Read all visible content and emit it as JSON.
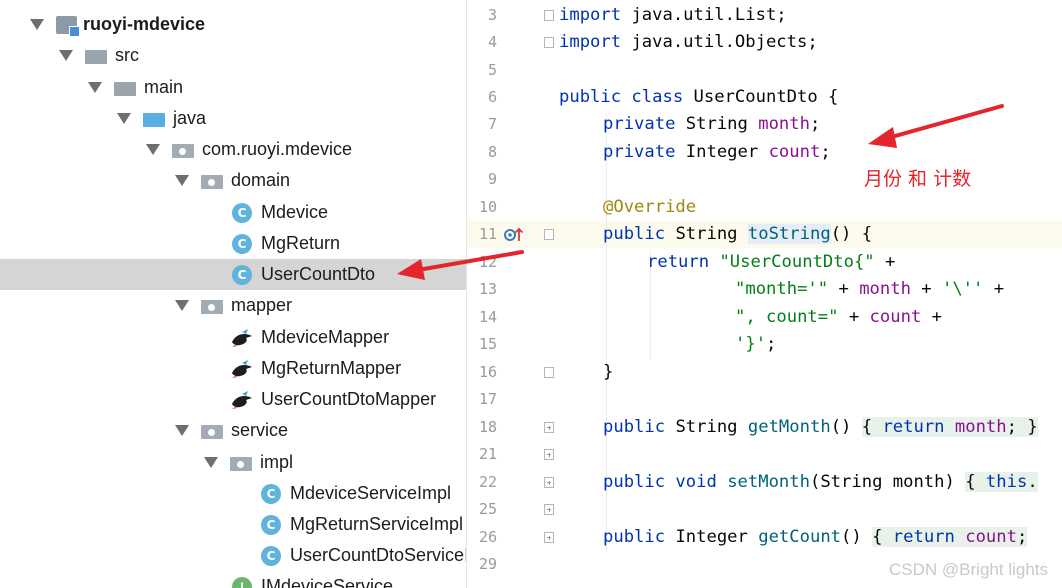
{
  "project_tree": {
    "items": [
      {
        "label": "ruoyi-mdevice",
        "icon": "module-icon",
        "expanded": true
      },
      {
        "label": "src",
        "icon": "folder-icon",
        "expanded": true
      },
      {
        "label": "main",
        "icon": "folder-icon",
        "expanded": true
      },
      {
        "label": "java",
        "icon": "source-folder-icon",
        "expanded": true
      },
      {
        "label": "com.ruoyi.mdevice",
        "icon": "package-icon",
        "expanded": true
      },
      {
        "label": "domain",
        "icon": "package-icon",
        "expanded": true
      },
      {
        "label": "Mdevice",
        "icon": "class-icon"
      },
      {
        "label": "MgReturn",
        "icon": "class-icon"
      },
      {
        "label": "UserCountDto",
        "icon": "class-icon",
        "selected": true
      },
      {
        "label": "mapper",
        "icon": "package-icon",
        "expanded": true
      },
      {
        "label": "MdeviceMapper",
        "icon": "mybatis-mapper-icon"
      },
      {
        "label": "MgReturnMapper",
        "icon": "mybatis-mapper-icon"
      },
      {
        "label": "UserCountDtoMapper",
        "icon": "mybatis-mapper-icon"
      },
      {
        "label": "service",
        "icon": "package-icon",
        "expanded": true
      },
      {
        "label": "impl",
        "icon": "package-icon",
        "expanded": true
      },
      {
        "label": "MdeviceServiceImpl",
        "icon": "class-icon"
      },
      {
        "label": "MgReturnServiceImpl",
        "icon": "class-icon"
      },
      {
        "label": "UserCountDtoServiceImpl",
        "icon": "class-icon"
      },
      {
        "label": "IMdeviceService",
        "icon": "interface-icon"
      }
    ],
    "class_badge": "C",
    "interface_badge": "I"
  },
  "editor": {
    "line_numbers": [
      "3",
      "4",
      "5",
      "6",
      "7",
      "8",
      "9",
      "10",
      "11",
      "12",
      "13",
      "14",
      "15",
      "16",
      "17",
      "18",
      "21",
      "22",
      "25",
      "26",
      "29"
    ],
    "code": {
      "l3": {
        "kw": "import",
        "rest": " java.util.List;"
      },
      "l4": {
        "kw": "import",
        "rest": " java.util.Objects;"
      },
      "l6": {
        "kw": "public class",
        "rest": " UserCountDto {"
      },
      "l7": {
        "kw": "private",
        "type": " String ",
        "field": "month",
        "end": ";"
      },
      "l8": {
        "kw": "private",
        "type": " Integer ",
        "field": "count",
        "end": ";"
      },
      "l10": {
        "annotation": "@Override"
      },
      "l11": {
        "kw": "public",
        "type": " String ",
        "method": "toString",
        "end": "() {"
      },
      "l12": {
        "kw": "return",
        "str": " \"UserCountDto{\"",
        "end": " +"
      },
      "l13": {
        "str": "\"month='\"",
        "mid": " + ",
        "field": "month",
        "end": " + ",
        "str2": "'\\''",
        "end2": " +"
      },
      "l14": {
        "str": "\", count=\"",
        "mid": " + ",
        "field": "count",
        "end": " +"
      },
      "l15": {
        "str": "'}'",
        "end": ";"
      },
      "l16": {
        "end": "}"
      },
      "l18": {
        "kw": "public",
        "type": " String ",
        "method": "getMonth",
        "end": "() ",
        "fold": "{ ",
        "kw2": "return",
        "field": " month",
        "end2": "; }"
      },
      "l22": {
        "kw": "public void",
        "type": " ",
        "method": "setMonth",
        "end": "(String month) ",
        "fold": "{ ",
        "kw2": "this",
        "end2": "."
      },
      "l26": {
        "kw": "public",
        "type": " Integer ",
        "method": "getCount",
        "end": "() ",
        "fold": "{ ",
        "kw2": "return",
        "field": " count",
        "end2": ";"
      }
    }
  },
  "annotations": {
    "note": "月份 和 计数"
  },
  "watermark": "CSDN @Bright lights",
  "colors": {
    "keyword": "#0033b3",
    "string": "#067d17",
    "field": "#871094",
    "annotation": "#9e880d",
    "arrow": "#e4252b",
    "selection": "#d5d5d5"
  }
}
